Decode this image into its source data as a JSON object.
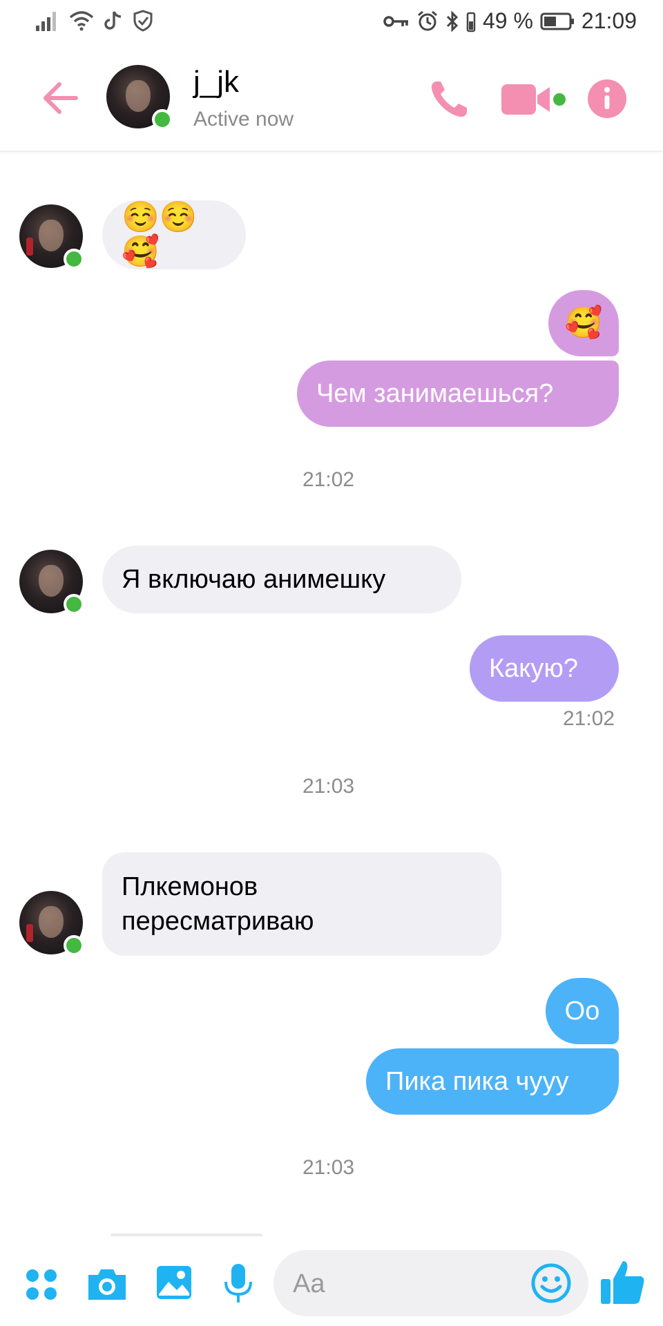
{
  "status_bar": {
    "battery_percent": "49 %",
    "time": "21:09"
  },
  "header": {
    "contact_name": "j_jk",
    "contact_status": "Active now"
  },
  "messages": [
    {
      "sender": "contact",
      "text": "☺️☺️🥰"
    },
    {
      "sender": "me",
      "text": "🥰"
    },
    {
      "sender": "me",
      "text": "Чем занимаешься?"
    },
    {
      "sender": "timestamp",
      "text": "21:02"
    },
    {
      "sender": "contact",
      "text": "Я включаю анимешку"
    },
    {
      "sender": "me",
      "text": "Какую?"
    },
    {
      "sender": "delivered_time",
      "text": "21:02"
    },
    {
      "sender": "timestamp",
      "text": "21:03"
    },
    {
      "sender": "contact",
      "text": "Плкемонов пересматриваю"
    },
    {
      "sender": "me",
      "text": "Оо"
    },
    {
      "sender": "me",
      "text": "Пика пика чууу"
    },
    {
      "sender": "timestamp",
      "text": "21:03"
    }
  ],
  "composer": {
    "placeholder": "Aa"
  },
  "colors": {
    "accent_pink": "#f48fb1",
    "bubble_in": "#f0eff4",
    "bubble_out_violet": "#d59be0",
    "bubble_out_purple": "#b39cf4",
    "bubble_out_blue": "#4cb3f8",
    "toolbar_blue": "#1fb3f2",
    "online_green": "#44b840"
  },
  "icons": {
    "status_left": [
      "signal-icon",
      "wifi-icon",
      "tiktok-icon",
      "shield-check-icon"
    ],
    "status_right": [
      "key-icon",
      "alarm-icon",
      "bluetooth-icon",
      "battery-icon"
    ],
    "header": [
      "back-arrow-icon",
      "phone-icon",
      "video-camera-icon",
      "info-icon"
    ],
    "bottom": [
      "apps-icon",
      "camera-icon",
      "gallery-icon",
      "microphone-icon",
      "emoji-icon",
      "thumbs-up-icon"
    ]
  }
}
